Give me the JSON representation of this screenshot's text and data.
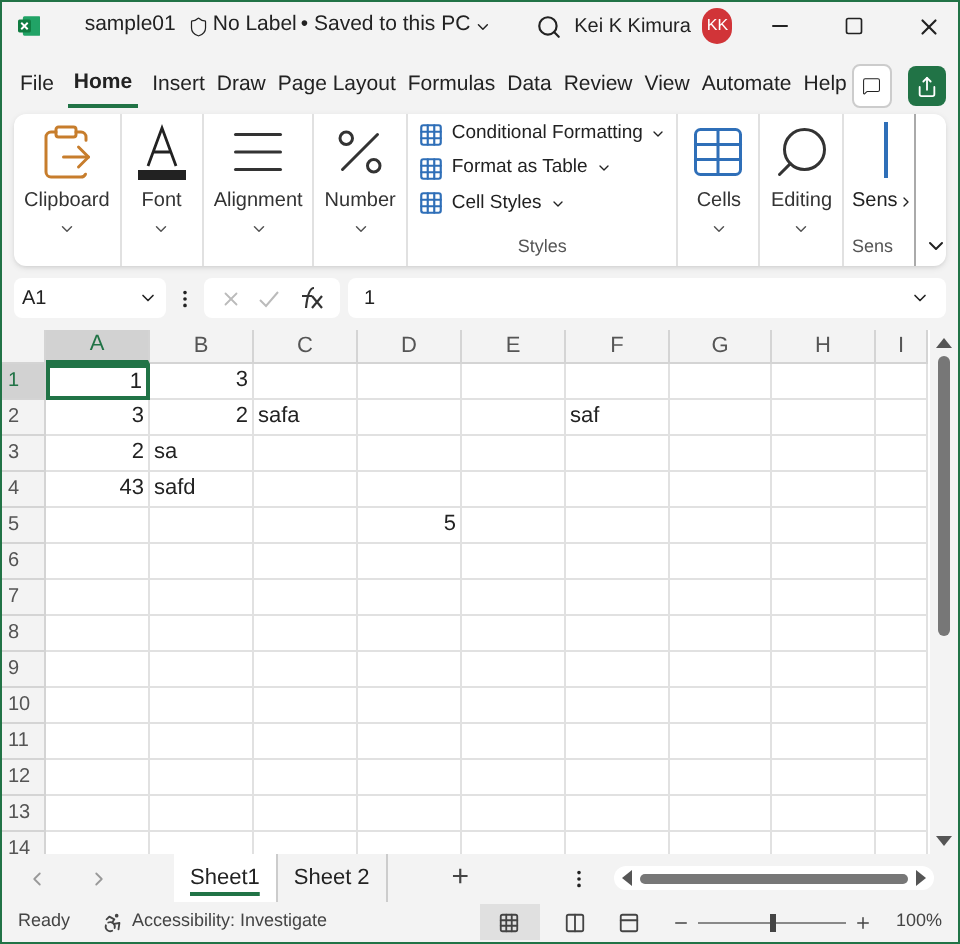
{
  "title_bar": {
    "file_name": "sample01",
    "label": "No Label",
    "save_state": "• Saved to this PC",
    "user": "Kei K Kimura",
    "avatar": "KK"
  },
  "menu_tabs": [
    {
      "label": "File",
      "selected": false
    },
    {
      "label": "Home",
      "selected": true
    },
    {
      "label": "Insert",
      "selected": false
    },
    {
      "label": "Draw",
      "selected": false
    },
    {
      "label": "Page Layout",
      "selected": false
    },
    {
      "label": "Formulas",
      "selected": false
    },
    {
      "label": "Data",
      "selected": false
    },
    {
      "label": "Review",
      "selected": false
    },
    {
      "label": "View",
      "selected": false
    },
    {
      "label": "Automate",
      "selected": false
    },
    {
      "label": "Help",
      "selected": false
    }
  ],
  "ribbon": {
    "groups": [
      {
        "kind": "clipboard",
        "label": "Clipboard"
      },
      {
        "kind": "font",
        "label": "Font"
      },
      {
        "kind": "alignment",
        "label": "Alignment"
      },
      {
        "kind": "number",
        "label": "Number"
      }
    ],
    "styles": {
      "items": [
        "Conditional Formatting",
        "Format as Table",
        "Cell Styles"
      ],
      "label": "Styles"
    },
    "groups_right": [
      {
        "kind": "cells",
        "label": "Cells"
      },
      {
        "kind": "editing",
        "label": "Editing"
      }
    ],
    "sensitivity": {
      "label": "Sens",
      "group_label": "Sens"
    }
  },
  "formula_bar": {
    "name_box": "A1",
    "formula": "1"
  },
  "sheet": {
    "columns": [
      "A",
      "B",
      "C",
      "D",
      "E",
      "F",
      "G",
      "H",
      "I"
    ],
    "rows": [
      {
        "header": "1",
        "cells": [
          {
            "text": "1",
            "kind": "number",
            "selected": true
          },
          {
            "text": "3",
            "kind": "number",
            "selected": false
          },
          null,
          null,
          null,
          null,
          null,
          null,
          null
        ]
      },
      {
        "header": "2",
        "cells": [
          {
            "text": "3",
            "kind": "number",
            "selected": false
          },
          {
            "text": "2",
            "kind": "number",
            "selected": false
          },
          {
            "text": "safa",
            "kind": "text",
            "selected": false
          },
          null,
          null,
          {
            "text": "saf",
            "kind": "text",
            "selected": false
          },
          null,
          null,
          null
        ]
      },
      {
        "header": "3",
        "cells": [
          {
            "text": "2",
            "kind": "number",
            "selected": false
          },
          {
            "text": "sa",
            "kind": "text",
            "selected": false
          },
          null,
          null,
          null,
          null,
          null,
          null,
          null
        ]
      },
      {
        "header": "4",
        "cells": [
          {
            "text": "43",
            "kind": "number",
            "selected": false
          },
          {
            "text": "safd",
            "kind": "text",
            "selected": false
          },
          null,
          null,
          null,
          null,
          null,
          null,
          null
        ]
      },
      {
        "header": "5",
        "cells": [
          null,
          null,
          null,
          {
            "text": "5",
            "kind": "number",
            "selected": false
          },
          null,
          null,
          null,
          null,
          null
        ]
      },
      {
        "header": "6"
      },
      {
        "header": "7"
      },
      {
        "header": "8"
      },
      {
        "header": "9"
      },
      {
        "header": "10"
      },
      {
        "header": "11"
      },
      {
        "header": "12"
      },
      {
        "header": "13"
      },
      {
        "header": "14"
      }
    ]
  },
  "sheet_tabs": [
    {
      "label": "Sheet1",
      "selected": true
    },
    {
      "label": "Sheet 2",
      "selected": false
    }
  ],
  "add_sheet": "+",
  "status_bar": {
    "status": "Ready",
    "accessibility": "Accessibility: Investigate",
    "zoom": "100%",
    "zoom_level": {
      "level": 0.5
    }
  }
}
